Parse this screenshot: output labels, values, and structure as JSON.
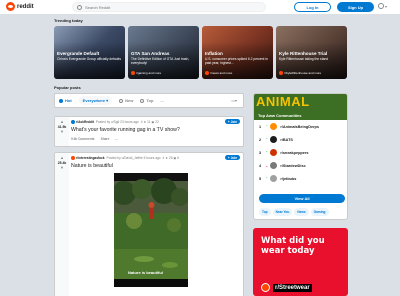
{
  "header": {
    "logo_text": "reddit",
    "search_placeholder": "Search Reddit",
    "login_label": "Log In",
    "signup_label": "Sign Up"
  },
  "trending": {
    "title": "Trending today",
    "cards": [
      {
        "title": "Evergrande Default",
        "desc": "China's Evergrande Group officially defaults",
        "sub": "",
        "color": "#5a6a86"
      },
      {
        "title": "GTA San Andreas",
        "desc": "The Definitive Edition of GTA Just trash, everybody!",
        "sub": "r/gaming and more",
        "color": "#4a5566"
      },
      {
        "title": "Inflation",
        "desc": "U.S. consumer prices spiked 6.2 percent in past year, highest...",
        "sub": "r/news and more",
        "color": "#7b3b2a"
      },
      {
        "title": "Kyle Rittenhouse Trial",
        "desc": "Kyle Rittenhouse taking the stand",
        "sub": "r/KyleRittenhouse and more",
        "color": "#6b5145"
      }
    ]
  },
  "popular": {
    "title": "Popular posts",
    "sort": {
      "hot": "Hot",
      "region": "Everywhere",
      "new": "New",
      "top": "Top",
      "more": "..."
    }
  },
  "posts": [
    {
      "score": "41.9k",
      "subreddit": "r/AskReddit",
      "meta": "Posted by u/Sg6 23 hours ago",
      "awards": "4 ★ 11 ▣ 22",
      "join_label": "+ Join",
      "title": "What's your favorite running gag in a TV show?",
      "comments": "9.9k Comments",
      "share": "Share",
      "more": "..."
    },
    {
      "score": "25.4k",
      "subreddit": "r/interestingasfuck",
      "meta": "Posted by u/David_Jeffrie 5 hours ago",
      "awards": "4 ★ 25 ▣ 6",
      "join_label": "+ Join",
      "title": "Nature is beautiful",
      "caption": "Nature is beautiful"
    }
  ],
  "sidebar": {
    "banner_big": "ANIMAL",
    "banner_caption": "Top Aww Communities",
    "communities": [
      {
        "rank": "1",
        "arrow": "up",
        "name": "r/AnimalsBeingDerps",
        "color": "#ff8c00"
      },
      {
        "rank": "2",
        "arrow": "up",
        "name": "r/BATS",
        "color": "#1c1c1c"
      },
      {
        "rank": "3",
        "arrow": "up",
        "name": "r/sneakpeppers",
        "color": "#cc3300"
      },
      {
        "rank": "4",
        "arrow": "down",
        "name": "r/StardewDisc",
        "color": "#7a7a7a"
      },
      {
        "rank": "5",
        "arrow": "up",
        "name": "r/jetbubs",
        "color": "#a0a0a0"
      }
    ],
    "view_all": "View All",
    "tags": [
      "Top",
      "Near You",
      "News",
      "Gaming"
    ]
  },
  "ad": {
    "text": "What did you wear today",
    "sub": "r/Streetwear"
  }
}
